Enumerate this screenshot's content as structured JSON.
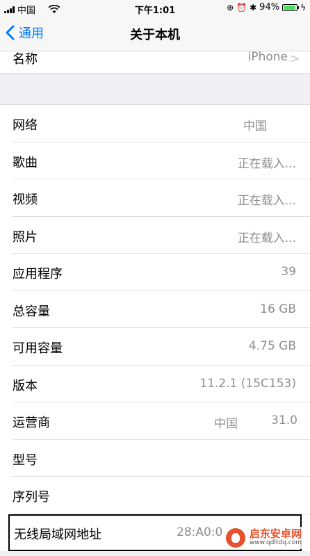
{
  "status_bar": {
    "carrier": "中国",
    "time": "下午1:01",
    "battery_percent": "94%",
    "battery_level": 0.94
  },
  "nav": {
    "back_label": "通用",
    "title": "关于本机"
  },
  "name_row": {
    "label": "名称",
    "value": "iPhone"
  },
  "rows": [
    {
      "label": "网络",
      "value": "中国"
    },
    {
      "label": "歌曲",
      "value": "正在载入..."
    },
    {
      "label": "视频",
      "value": "正在载入..."
    },
    {
      "label": "照片",
      "value": "正在载入..."
    },
    {
      "label": "应用程序",
      "value": "39"
    },
    {
      "label": "总容量",
      "value": "16 GB"
    },
    {
      "label": "可用容量",
      "value": "4.75 GB"
    },
    {
      "label": "版本",
      "value": "11.2.1 (15C153)"
    },
    {
      "label": "运营商",
      "value": "中国",
      "value2": "31.0"
    },
    {
      "label": "型号",
      "value": ""
    },
    {
      "label": "序列号",
      "value": ""
    },
    {
      "label": "无线局域网地址",
      "value": "28:A0:0"
    }
  ],
  "watermark": {
    "title": "启东安卓网",
    "url": "www.qdltdq.com"
  },
  "colors": {
    "accent": "#007aff",
    "secondary_text": "#8e8e93",
    "background": "#efeff4",
    "battery": "#4cd964"
  }
}
